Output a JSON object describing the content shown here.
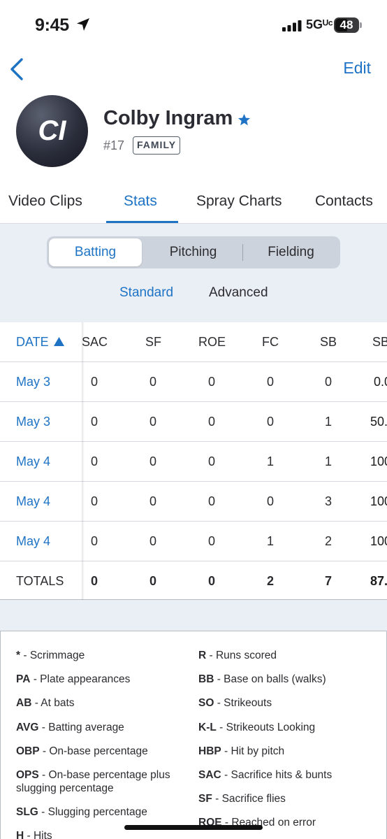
{
  "status_bar": {
    "time": "9:45",
    "network": "5Gᵁᶜ",
    "battery": "48"
  },
  "nav": {
    "edit_label": "Edit"
  },
  "profile": {
    "initials": "CI",
    "name": "Colby Ingram",
    "number": "#17",
    "badge": "FAMILY"
  },
  "tabs": [
    {
      "label": "Video Clips"
    },
    {
      "label": "Stats"
    },
    {
      "label": "Spray Charts"
    },
    {
      "label": "Contacts"
    }
  ],
  "segments": [
    {
      "label": "Batting"
    },
    {
      "label": "Pitching"
    },
    {
      "label": "Fielding"
    }
  ],
  "sub_tabs": [
    {
      "label": "Standard"
    },
    {
      "label": "Advanced"
    }
  ],
  "table": {
    "date_header": "DATE",
    "columns": [
      "SAC",
      "SF",
      "ROE",
      "FC",
      "SB",
      "SB"
    ],
    "rows": [
      {
        "date": "May 3",
        "values": [
          "0",
          "0",
          "0",
          "0",
          "0",
          "0.0"
        ]
      },
      {
        "date": "May 3",
        "values": [
          "0",
          "0",
          "0",
          "0",
          "1",
          "50."
        ]
      },
      {
        "date": "May 4",
        "values": [
          "0",
          "0",
          "0",
          "1",
          "1",
          "100"
        ]
      },
      {
        "date": "May 4",
        "values": [
          "0",
          "0",
          "0",
          "0",
          "3",
          "100"
        ]
      },
      {
        "date": "May 4",
        "values": [
          "0",
          "0",
          "0",
          "1",
          "2",
          "100"
        ]
      }
    ],
    "totals": {
      "label": "TOTALS",
      "values": [
        "0",
        "0",
        "0",
        "2",
        "7",
        "87."
      ]
    }
  },
  "legend": {
    "left": [
      {
        "key": "*",
        "desc": " - Scrimmage"
      },
      {
        "key": "PA",
        "desc": " - Plate appearances"
      },
      {
        "key": "AB",
        "desc": " - At bats"
      },
      {
        "key": "AVG",
        "desc": " - Batting average"
      },
      {
        "key": "OBP",
        "desc": " - On-base percentage"
      },
      {
        "key": "OPS",
        "desc": " - On-base percentage plus slugging percentage"
      },
      {
        "key": "SLG",
        "desc": " - Slugging percentage"
      },
      {
        "key": "H",
        "desc": " - Hits"
      }
    ],
    "right": [
      {
        "key": "R",
        "desc": " - Runs scored"
      },
      {
        "key": "BB",
        "desc": " - Base on balls (walks)"
      },
      {
        "key": "SO",
        "desc": " - Strikeouts"
      },
      {
        "key": "K-L",
        "desc": " - Strikeouts Looking"
      },
      {
        "key": "HBP",
        "desc": " - Hit by pitch"
      },
      {
        "key": "SAC",
        "desc": " - Sacrifice hits & bunts"
      },
      {
        "key": "SF",
        "desc": " - Sacrifice flies"
      },
      {
        "key": "ROE",
        "desc": " - Reached on error"
      }
    ]
  },
  "colors": {
    "accent": "#1e73c5",
    "panel_bg": "#eaeff6"
  },
  "icons": [
    "location-arrow-icon",
    "signal-icon",
    "battery-icon",
    "chevron-left-icon",
    "star-icon",
    "sort-up-icon"
  ]
}
